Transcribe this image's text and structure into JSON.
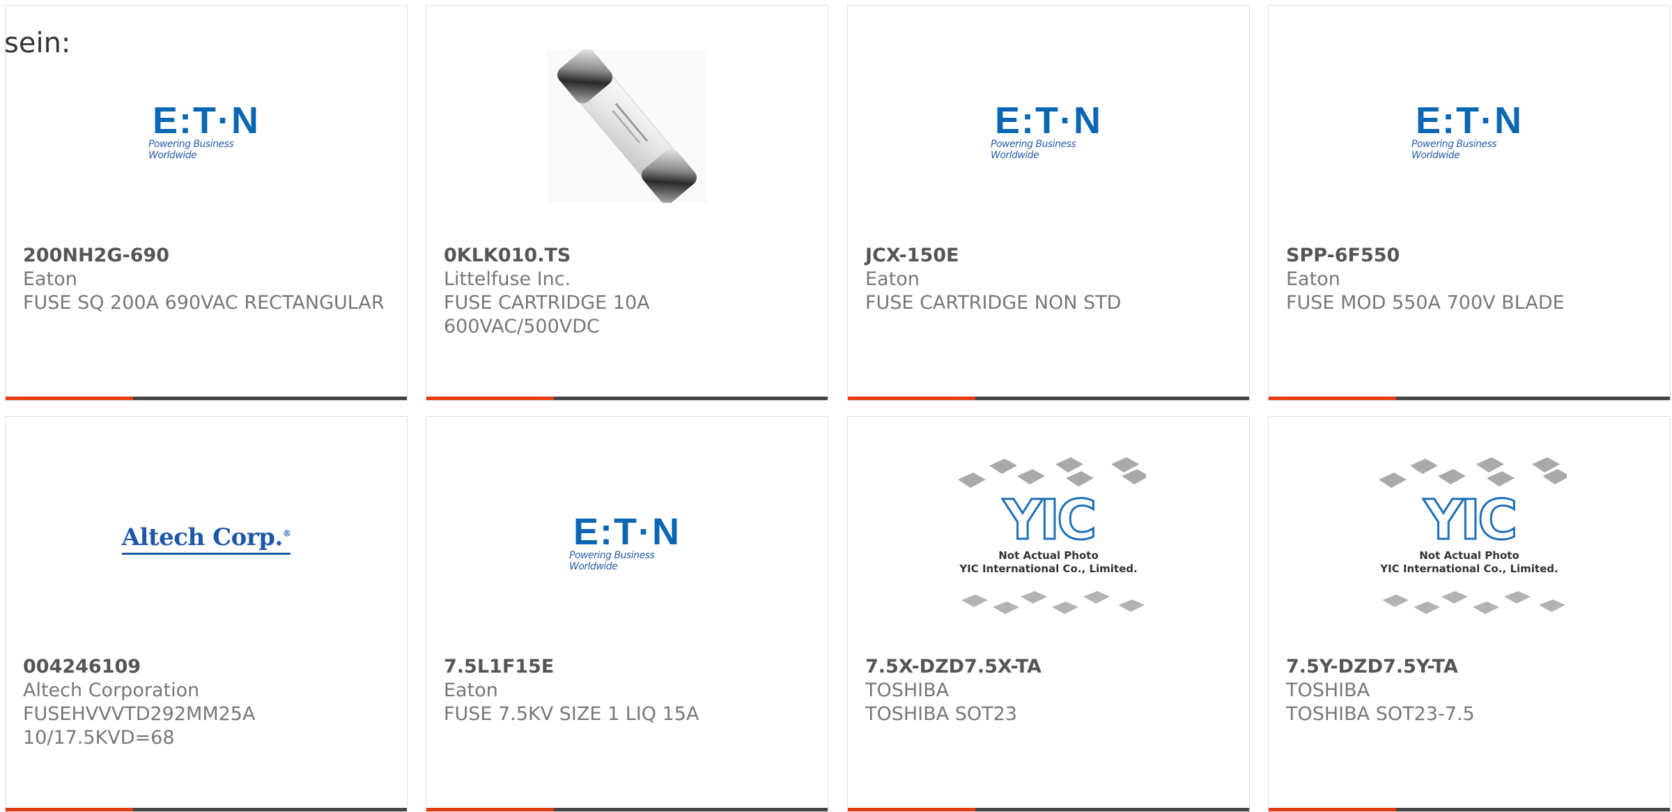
{
  "lead_text": "sein:",
  "colors": {
    "accent": "#e53b12",
    "bar": "#444444",
    "eaton_blue": "#0b66b3"
  },
  "products": [
    {
      "part": "200NH2G-690",
      "manufacturer": "Eaton",
      "description": "FUSE SQ 200A 690VAC RECTANGULAR",
      "image": "eaton-logo"
    },
    {
      "part": "0KLK010.TS",
      "manufacturer": "Littelfuse Inc.",
      "description": "FUSE CARTRIDGE 10A 600VAC/500VDC",
      "image": "cartridge-fuse-photo"
    },
    {
      "part": "JCX-150E",
      "manufacturer": "Eaton",
      "description": "FUSE CARTRIDGE NON STD",
      "image": "eaton-logo"
    },
    {
      "part": "SPP-6F550",
      "manufacturer": "Eaton",
      "description": "FUSE MOD 550A 700V BLADE",
      "image": "eaton-logo"
    },
    {
      "part": "004246109",
      "manufacturer": "Altech Corporation",
      "description": "FUSEHVVVTD292MM25A 10/17.5KVD=68",
      "image": "altech-logo"
    },
    {
      "part": "7.5L1F15E",
      "manufacturer": "Eaton",
      "description": "FUSE 7.5KV SIZE 1 LIQ 15A",
      "image": "eaton-logo"
    },
    {
      "part": "7.5X-DZD7.5X-TA",
      "manufacturer": "TOSHIBA",
      "description": "TOSHIBA SOT23",
      "image": "yic-placeholder"
    },
    {
      "part": "7.5Y-DZD7.5Y-TA",
      "manufacturer": "TOSHIBA",
      "description": "TOSHIBA SOT23-7.5",
      "image": "yic-placeholder"
    }
  ],
  "logos": {
    "eaton_word": "E:T·N",
    "eaton_tagline": "Powering Business Worldwide",
    "altech_word": "Altech Corp.",
    "yic_word": "YIC",
    "yic_line1": "Not Actual Photo",
    "yic_line2": "YIC International Co., Limited."
  }
}
